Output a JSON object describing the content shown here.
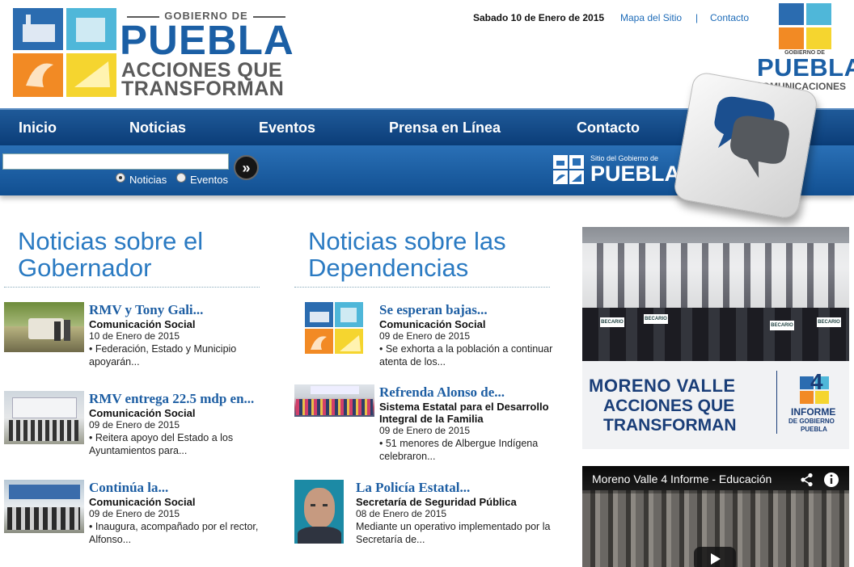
{
  "header": {
    "logo": {
      "gobierno": "GOBIERNO DE",
      "puebla": "PUEBLA",
      "slogan_1": "ACCIONES QUE",
      "slogan_2": "TRANSFORMAN"
    },
    "date": "Sabado 10 de Enero de 2015",
    "links": {
      "mapa": "Mapa del Sitio",
      "separator": "|",
      "contacto": "Contacto"
    },
    "com_logo": {
      "gobierno": "GOBIERNO DE",
      "puebla": "PUEBLA",
      "comunicaciones": "COMUNICACIONES"
    }
  },
  "nav": {
    "items": [
      "Inicio",
      "Noticias",
      "Eventos",
      "Prensa en Línea",
      "Contacto"
    ]
  },
  "search": {
    "placeholder": "",
    "button": "»",
    "options": [
      "Noticias",
      "Eventos"
    ],
    "selected": "Noticias"
  },
  "sitio": {
    "label": "Sitio del Gobierno de",
    "puebla": "PUEBLA"
  },
  "sections": {
    "gobernador": {
      "title_1": "Noticias sobre el",
      "title_2": "Gobernador",
      "items": [
        {
          "title": "RMV y Tony Gali...",
          "source": "Comunicación Social",
          "date": "10 de Enero de 2015",
          "excerpt_1": "• Federación, Estado y Municipio",
          "excerpt_2": "apoyarán..."
        },
        {
          "title": "RMV entrega 22.5 mdp en...",
          "source": "Comunicación Social",
          "date": "09 de Enero de 2015",
          "excerpt_1": "• Reitera apoyo del Estado a los",
          "excerpt_2": "Ayuntamientos para..."
        },
        {
          "title": "Continúa la...",
          "source": "Comunicación Social",
          "date": "09 de Enero de 2015",
          "excerpt_1": "• Inaugura, acompañado por el rector,",
          "excerpt_2": "Alfonso..."
        }
      ]
    },
    "dependencias": {
      "title_1": "Noticias sobre las",
      "title_2": "Dependencias",
      "items": [
        {
          "title": "Se esperan bajas...",
          "source_1": "Comunicación Social",
          "source_2": "",
          "date": "09 de Enero de 2015",
          "excerpt_1": "• Se exhorta a la población a continuar",
          "excerpt_2": "atenta de los..."
        },
        {
          "title": "Refrenda Alonso de...",
          "source_1": "Sistema Estatal para el Desarrollo",
          "source_2": "Integral de la Familia",
          "date": "09 de Enero de 2015",
          "excerpt_1": "• 51 menores de Albergue Indígena",
          "excerpt_2": "celebraron..."
        },
        {
          "title": "La Policía Estatal...",
          "source_1": "Secretaría de Seguridad Pública",
          "source_2": "",
          "date": "08 de Enero de 2015",
          "excerpt_1": "Mediante un operativo implementado por la",
          "excerpt_2": "Secretaría de..."
        }
      ]
    }
  },
  "banner": {
    "line_1": "MORENO VALLE",
    "line_2": "ACCIONES QUE",
    "line_3": "TRANSFORMAN",
    "informe_num": "4",
    "informe_1": "INFORME",
    "informe_2": "DE GOBIERNO",
    "informe_3": "PUEBLA",
    "sign": "BECARIO"
  },
  "video": {
    "title": "Moreno Valle 4 Informe - Educación"
  },
  "colors": {
    "brand_blue": "#1b5fa5",
    "nav_dark": "#0b3d78",
    "title_blue": "#2a7ac2",
    "link_blue": "#1d6bb8"
  }
}
